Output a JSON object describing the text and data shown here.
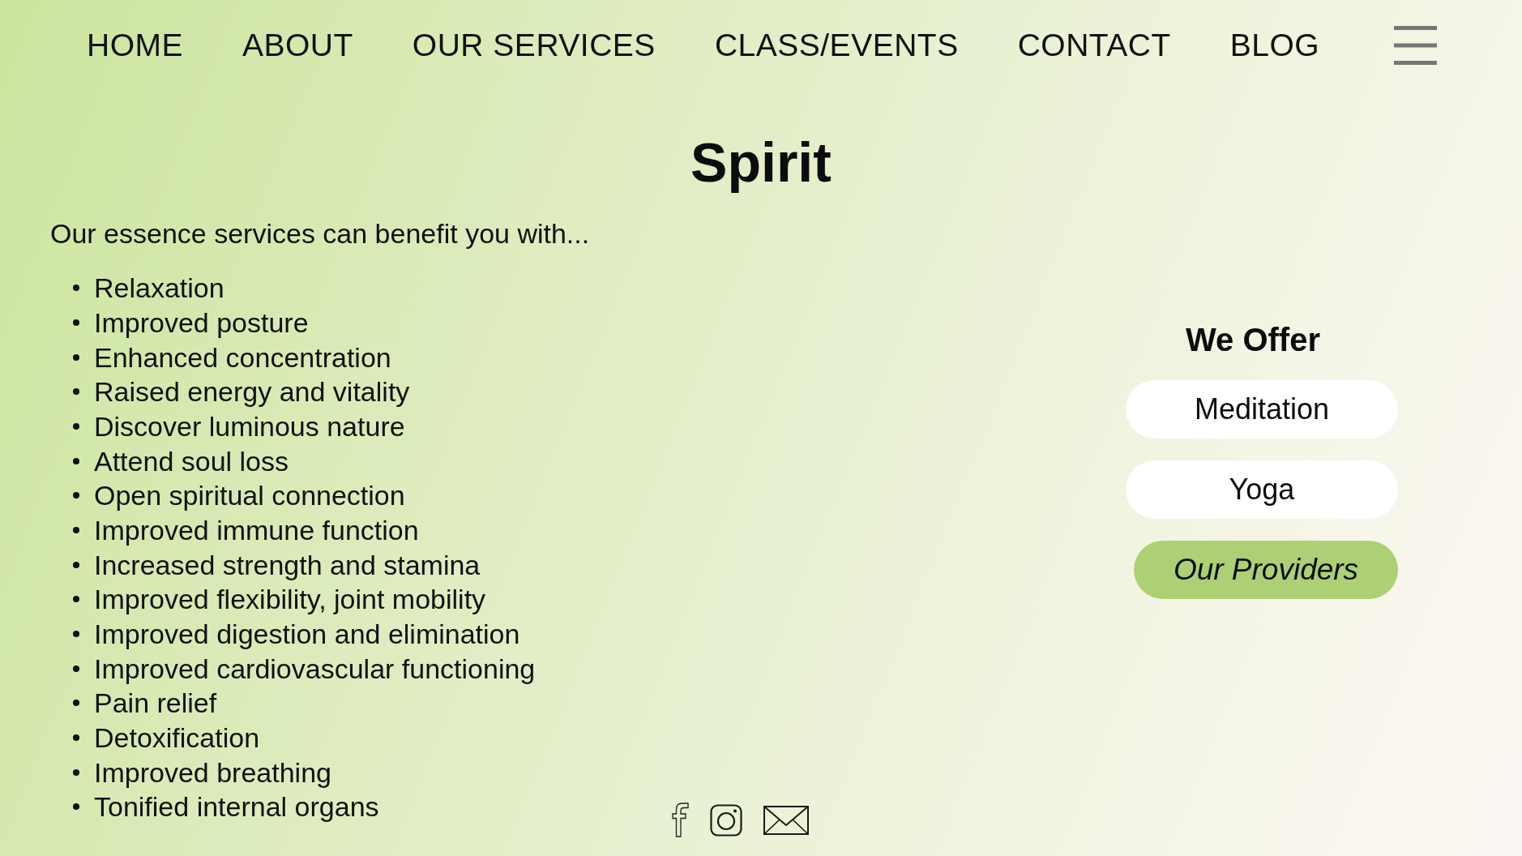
{
  "nav": [
    "HOME",
    "ABOUT",
    "OUR SERVICES",
    "CLASS/EVENTS",
    "CONTACT",
    "BLOG"
  ],
  "title": "Spirit",
  "intro": "Our essence services can benefit you with...",
  "benefits": [
    "Relaxation",
    "Improved posture",
    "Enhanced concentration",
    "Raised energy and vitality",
    "Discover luminous nature",
    "Attend soul loss",
    "Open spiritual connection",
    "Improved immune function",
    "Increased strength and stamina",
    "Improved flexibility, joint mobility",
    "Improved digestion and elimination",
    "Improved cardiovascular functioning",
    "Pain relief",
    "Detoxification",
    "Improved breathing",
    "Tonified internal organs"
  ],
  "offer_panel": {
    "heading": "We Offer",
    "options": [
      "Meditation",
      "Yoga"
    ],
    "providers_button": "Our Providers"
  }
}
